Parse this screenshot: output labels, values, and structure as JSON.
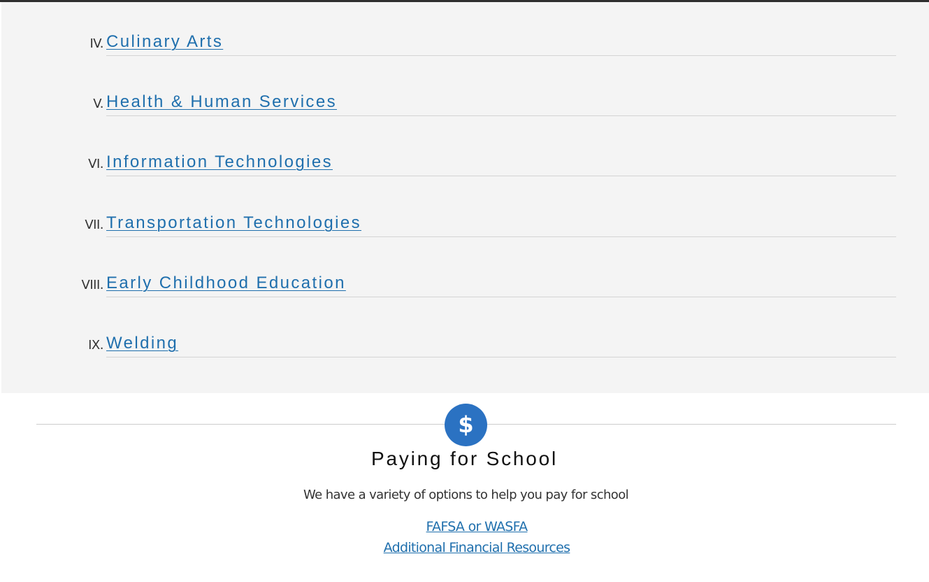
{
  "programs": [
    {
      "numeral": "IV.",
      "label": "Culinary Arts"
    },
    {
      "numeral": "V.",
      "label": "Health & Human Services"
    },
    {
      "numeral": "VI.",
      "label": "Information Technologies"
    },
    {
      "numeral": "VII.",
      "label": "Transportation Technologies"
    },
    {
      "numeral": "VIII.",
      "label": "Early Childhood Education"
    },
    {
      "numeral": "IX.",
      "label": "Welding"
    }
  ],
  "paying": {
    "icon": "dollar-icon",
    "icon_glyph": "$",
    "title": "Paying for School",
    "subtitle": "We have a variety of options to help you pay for school",
    "links": [
      {
        "label": "FAFSA or WASFA"
      },
      {
        "label": "Additional Financial Resources"
      }
    ]
  },
  "colors": {
    "link": "#1f6fad",
    "badge": "#2b72c2",
    "panel_background": "#f4f4f4"
  }
}
